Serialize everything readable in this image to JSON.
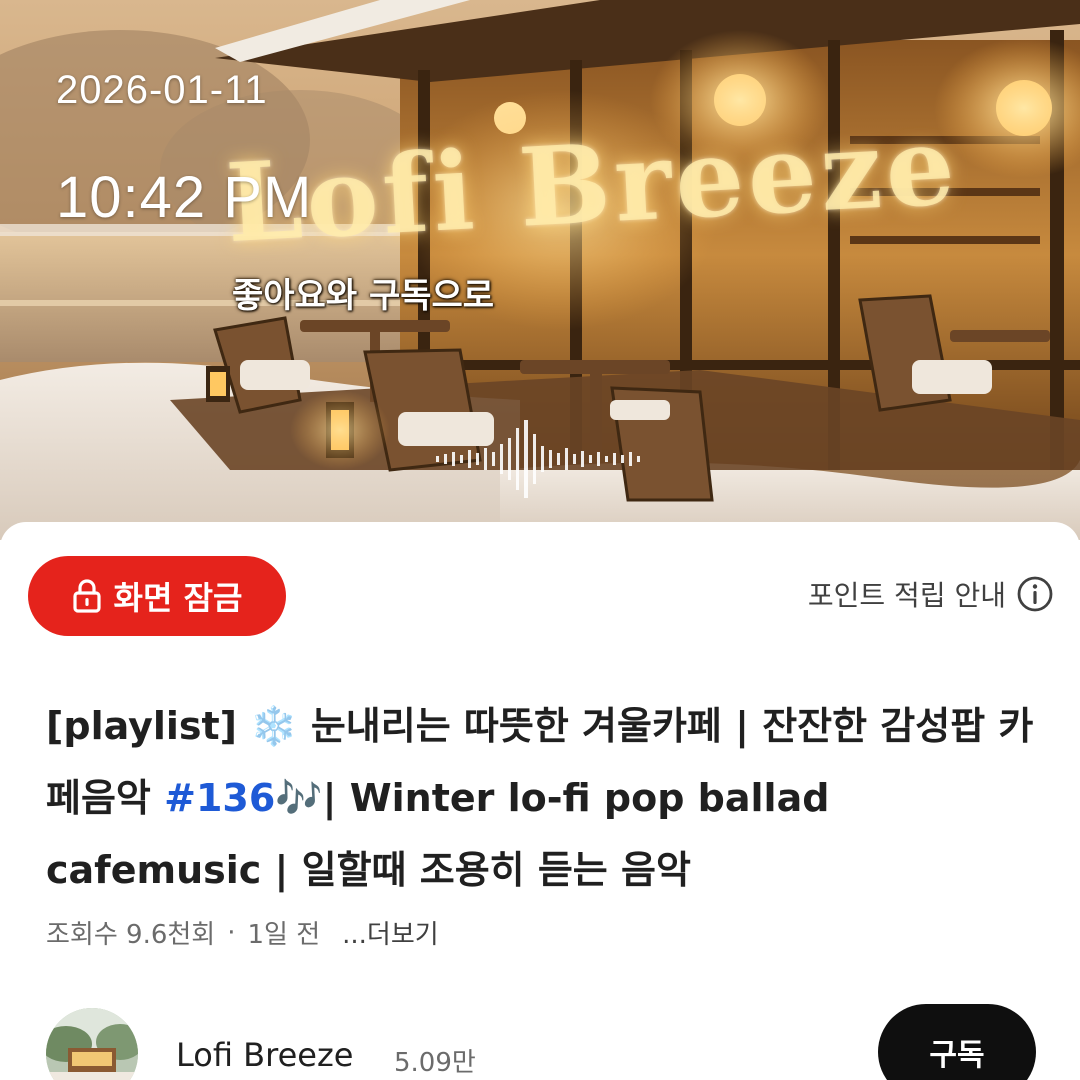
{
  "video": {
    "overlay_date": "2026-01-11",
    "overlay_time": "10:42 PM",
    "overlay_brand": "Lofi Breeze",
    "overlay_subtitle": "좋아요와 구독으로"
  },
  "actions": {
    "screen_lock_label": "화면 잠금",
    "screen_lock_icon": "lock-icon",
    "points_info_label": "포인트 적립 안내",
    "points_info_icon": "info-icon"
  },
  "title": {
    "prefix": "[playlist] ",
    "emoji_snowflake": "❄️",
    "part1": " 눈내리는 따뜻한 겨울카페 | 잔잔한 감성팝 카페음악 ",
    "hashtag": "#136",
    "emoji_notes": "🎶",
    "part2": "| Winter lo-fi pop ballad cafemusic | 일할때 조용히 듣는 음악"
  },
  "meta": {
    "views": "조회수 9.6천회",
    "separator": "·",
    "age": "1일 전",
    "more": "...더보기"
  },
  "channel": {
    "name": "Lofi Breeze",
    "subscribers": "5.09만",
    "subscribe_label": "구독"
  },
  "colors": {
    "accent_red": "#e5231c",
    "hashtag_blue": "#1e5ad6",
    "subscribe_bg": "#0f0f0f",
    "text_primary": "#202020",
    "text_secondary": "#6b6b6b"
  }
}
